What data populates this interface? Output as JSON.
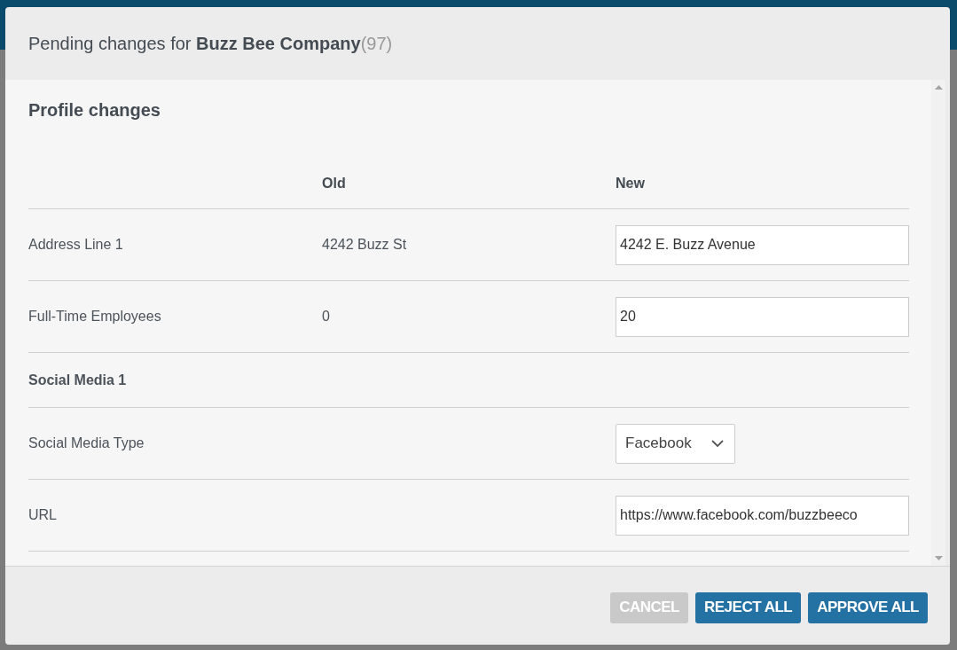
{
  "dialog": {
    "title": "Pending changes for **Buzz Bee Company**",
    "count": "(97)",
    "section_title": "Profile changes",
    "columns": [
      "Old",
      "New"
    ],
    "rows": [
      {
        "kind": "field",
        "label": "Address Line 1",
        "old": "4242 Buzz St",
        "new": {
          "kind": "input",
          "value": "4242 E. Buzz Avenue"
        }
      },
      {
        "kind": "field",
        "label": "Full-Time Employees",
        "old": "0",
        "new": {
          "kind": "input",
          "value": "20"
        }
      },
      {
        "kind": "section",
        "label": "Social Media 1"
      },
      {
        "kind": "field",
        "label": "Social Media Type",
        "new": {
          "kind": "select",
          "value": "Facebook"
        }
      },
      {
        "kind": "field",
        "label": "URL",
        "new": {
          "kind": "input",
          "value": "https://www.facebook.com/buzzbeeco"
        }
      }
    ],
    "buttons": [
      {
        "label": "CANCEL",
        "disabled": true
      },
      {
        "label": "REJECT ALL",
        "disabled": false
      },
      {
        "label": "APPROVE ALL",
        "disabled": false
      }
    ]
  }
}
